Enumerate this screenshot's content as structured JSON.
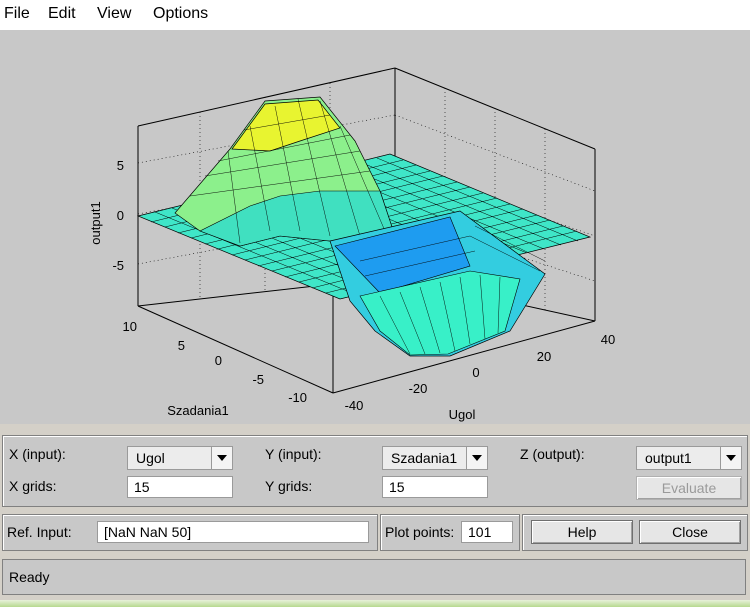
{
  "menu": {
    "items": [
      "File",
      "Edit",
      "View",
      "Options"
    ]
  },
  "surface_plot": {
    "z_label": "output1",
    "x_label": "Ugol",
    "y_label": "Szadania1",
    "z_ticks": [
      "5",
      "0",
      "-5"
    ],
    "x_ticks": [
      "-40",
      "-20",
      "0",
      "20",
      "40"
    ],
    "y_ticks": [
      "10",
      "5",
      "0",
      "-5",
      "-10"
    ]
  },
  "controls": {
    "x_input_label": "X (input):",
    "x_input_value": "Ugol",
    "y_input_label": "Y (input):",
    "y_input_value": "Szadania1",
    "z_output_label": "Z (output):",
    "z_output_value": "output1",
    "x_grids_label": "X grids:",
    "x_grids_value": "15",
    "y_grids_label": "Y grids:",
    "y_grids_value": "15",
    "evaluate_label": "Evaluate"
  },
  "ref": {
    "label": "Ref. Input:",
    "value": "[NaN NaN 50]",
    "plot_points_label": "Plot points:",
    "plot_points_value": "101",
    "help_label": "Help",
    "close_label": "Close"
  },
  "status": {
    "text": "Ready"
  }
}
